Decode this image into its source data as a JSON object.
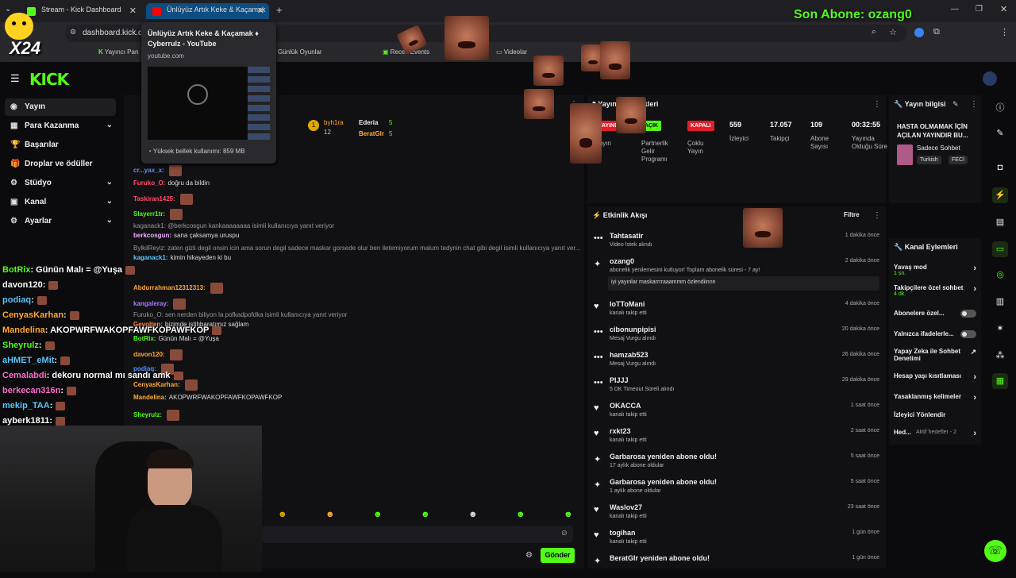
{
  "browser": {
    "tabs": [
      {
        "label": "Stream - Kick Dashboard",
        "fav": "#53fc18"
      },
      {
        "label": "Ünlüyüz Artık Keke & Kaçamak",
        "fav": "#ff0000"
      }
    ],
    "url": "dashboard.kick.co",
    "bookmarks": [
      "Yayıncı Pan",
      "Günlük Oyunlar",
      "Receit Events",
      "Videolar"
    ],
    "tooltip": {
      "title": "Ünlüyüz Artık Keke & Kaçamak ♦ Cyberrulz - YouTube",
      "domain": "youtube.com",
      "memory": "Yüksek bellek kullanımı: 859 MB"
    }
  },
  "overlay": {
    "last_sub": "Son Abone: ozang0",
    "badge": "X24"
  },
  "app": {
    "logo": "KICK",
    "nav": [
      {
        "label": "Yayın",
        "icon": "◉",
        "chev": false
      },
      {
        "label": "Para Kazanma",
        "icon": "▦",
        "chev": true
      },
      {
        "label": "Başarılar",
        "icon": "🏆",
        "chev": false
      },
      {
        "label": "Droplar ve ödüller",
        "icon": "🎁",
        "chev": false
      },
      {
        "label": "Stüdyo",
        "icon": "⚙",
        "chev": true
      },
      {
        "label": "Kanal",
        "icon": "▣",
        "chev": true
      },
      {
        "label": "Ayarlar",
        "icon": "⚙",
        "chev": true
      }
    ]
  },
  "chat": {
    "top": [
      {
        "rank": "1",
        "name": "byh1ra",
        "num": "12"
      },
      {
        "name": "Ederia",
        "num": "5"
      },
      {
        "name": "BeratGlr",
        "num": "5"
      }
    ],
    "messages": [
      {
        "user": "cr...yax_x:",
        "text": "",
        "color": "#5b8cff"
      },
      {
        "user": "Furuko_O:",
        "text": "doğru da bildin",
        "color": "#ff4d6d"
      },
      {
        "user": "Taskiran1425:",
        "text": "",
        "color": "#ff4d6d"
      },
      {
        "user": "Slayerr1tr:",
        "text": "",
        "color": "#53fc18"
      },
      {
        "user": "kaganack1: @berkcosgun kankaaaaaaaa isimli kullanıcıya yanıt veriyor",
        "text": "",
        "color": "#999"
      },
      {
        "user": "berkcosgun:",
        "text": "sana çaksamya uruspu",
        "color": "#f0b0ff"
      },
      {
        "user": "BylkilReyiz: zaten gizli degil onsin icin ama sorun degil sadece maskar gorsede olur ben iletemiyorum malum tedynin chat gibi degil isimli kullanıcıya yanıt ver...",
        "text": "",
        "color": "#999"
      },
      {
        "user": "kaganack1:",
        "text": "kimin hikayeden ki bu",
        "color": "#5bc8ff"
      },
      {
        "user": "Abdurrahman12312313:",
        "text": "",
        "color": "#ffaa33"
      },
      {
        "user": "kangaleray:",
        "text": "",
        "color": "#a77bff"
      },
      {
        "user": "Furuko_O: sen nerden biliyon la pofkadpofdka isimli kullanıcıya yanıt veriyor",
        "text": "",
        "color": "#999"
      },
      {
        "user": "Gevolten:",
        "text": "bizimde istihbaratımız sağlam",
        "color": "#ff8844"
      },
      {
        "user": "BotRix:",
        "text": "Günün Malı = @Yuşa",
        "color": "#53fc18"
      },
      {
        "user": "davon120:",
        "text": "",
        "color": "#ffaa33"
      },
      {
        "user": "podiaq:",
        "text": "",
        "color": "#5b8cff"
      },
      {
        "user": "CenyasKarhan:",
        "text": "",
        "color": "#ffaa33"
      },
      {
        "user": "Mandelina:",
        "text": "AKOPWRFWAKOPFAWFKOPAWFKOP",
        "color": "#ffaa33"
      },
      {
        "user": "Sheyrulz:",
        "text": "",
        "color": "#53fc18"
      }
    ],
    "send": "Gönder"
  },
  "overlay_chat": [
    {
      "user": "BotRix",
      "text": ": Günün Malı = @Yuşa",
      "color": "#53fc18"
    },
    {
      "user": "davon120",
      "text": ":",
      "color": "#ffffff"
    },
    {
      "user": "podiaq",
      "text": ":",
      "color": "#5bc8ff"
    },
    {
      "user": "CenyasKarhan",
      "text": ":",
      "color": "#ffaa33"
    },
    {
      "user": "Mandelina",
      "text": ": AKOPWRFWAKOPFAWFKOPAWFKOP",
      "color": "#ffaa33"
    },
    {
      "user": "Sheyrulz",
      "text": ":",
      "color": "#53fc18"
    },
    {
      "user": "aHMET_eMit",
      "text": ":",
      "color": "#5bc8ff"
    },
    {
      "user": "Cemalabdi",
      "text": ": dekoru normal mı sandı amk",
      "color": "#ff6fcf"
    },
    {
      "user": "berkecan316n",
      "text": ":",
      "color": "#ff6fcf"
    },
    {
      "user": "mekip_TAA",
      "text": ":",
      "color": "#5bc8ff"
    },
    {
      "user": "ayberk1811",
      "text": ":",
      "color": "#ffffff"
    }
  ],
  "stats": {
    "title": "Yayın İstatistikleri",
    "badges": [
      "YAYINDA",
      "AÇIK",
      "KAPALI"
    ],
    "badge_labels": [
      "Yayın",
      "Partnerlik Gelir Programı",
      "Çoklu Yayın"
    ],
    "values": [
      {
        "value": "559",
        "label": "İzleyici"
      },
      {
        "value": "17.057",
        "label": "Takipçi"
      },
      {
        "value": "109",
        "label": "Abone Sayısı"
      },
      {
        "value": "00:32:55",
        "label": "Yayında Olduğu Süre"
      }
    ]
  },
  "info": {
    "title": "Yayın bilgisi",
    "stream_title": "HASTA OLMAMAK İÇİN AÇILAN YAYINDIR BU...",
    "category": "Sadece Sohbet",
    "tags": [
      "Turkish",
      "FECİ"
    ]
  },
  "events": {
    "title": "Etkinlik Akışı",
    "filter": "Filtre",
    "items": [
      {
        "name": "Tahtasatir",
        "desc": "Video İstek alındı",
        "time": "1 dakika önce",
        "icon": "•••"
      },
      {
        "name": "ozang0",
        "desc": "abonelik yenilemesini kutluyor! Toplam abonelik süresi - 7 ay!",
        "time": "2 dakika önce",
        "icon": "✦",
        "note": "iyi yayınlar maskarrrraaammm özlendiinnn"
      },
      {
        "name": "loTToMani",
        "desc": "kanalı takip etti",
        "time": "4 dakika önce",
        "icon": "♥"
      },
      {
        "name": "cibonunpipisi",
        "desc": "Mesaj Vurgu alındı",
        "time": "20 dakika önce",
        "icon": "•••"
      },
      {
        "name": "hamzab523",
        "desc": "Mesaj Vurgu alındı",
        "time": "26 dakika önce",
        "icon": "•••"
      },
      {
        "name": "PIJJJ",
        "desc": "5 DK Timeout Süreli alındı",
        "time": "29 dakika önce",
        "icon": "•••"
      },
      {
        "name": "OKACCA",
        "desc": "kanalı takip etti",
        "time": "1 saat önce",
        "icon": "♥"
      },
      {
        "name": "rxkt23",
        "desc": "kanalı takip etti",
        "time": "2 saat önce",
        "icon": "♥"
      },
      {
        "name": "Garbarosa yeniden abone oldu!",
        "desc": "17 aylık abone oldular",
        "time": "5 saat önce",
        "icon": "✦"
      },
      {
        "name": "Garbarosa yeniden abone oldu!",
        "desc": "1 aylık abone oldular",
        "time": "5 saat önce",
        "icon": "✦"
      },
      {
        "name": "Waslov27",
        "desc": "kanalı takip etti",
        "time": "23 saat önce",
        "icon": "♥"
      },
      {
        "name": "togihan",
        "desc": "kanalı takip etti",
        "time": "1 gün önce",
        "icon": "♥"
      },
      {
        "name": "BeratGlr yeniden abone oldu!",
        "desc": "",
        "time": "1 gün önce",
        "icon": "✦"
      }
    ]
  },
  "channel_actions": {
    "title": "Kanal Eylemleri",
    "items": [
      {
        "label": "Yavaş mod",
        "sub": "1 sn.",
        "type": "arrow"
      },
      {
        "label": "Takipçilere özel sohbet",
        "sub": "4 dk.",
        "type": "arrow"
      },
      {
        "label": "Abonelere özel...",
        "sub": "",
        "type": "toggle"
      },
      {
        "label": "Yalnızca ifadelerle...",
        "sub": "",
        "type": "toggle"
      },
      {
        "label": "Yapay Zeka ile Sohbet Denetimi",
        "sub": "",
        "type": "ext"
      },
      {
        "label": "Hesap yaşı kısıtlaması",
        "sub": "",
        "type": "arrow"
      },
      {
        "label": "Yasaklanmış kelimeler",
        "sub": "",
        "type": "arrow"
      },
      {
        "label": "İzleyici Yönlendir",
        "sub": "",
        "type": "none"
      },
      {
        "label": "Hed...",
        "sub": "Aktif hedefler - 2",
        "type": "arrow"
      }
    ]
  }
}
